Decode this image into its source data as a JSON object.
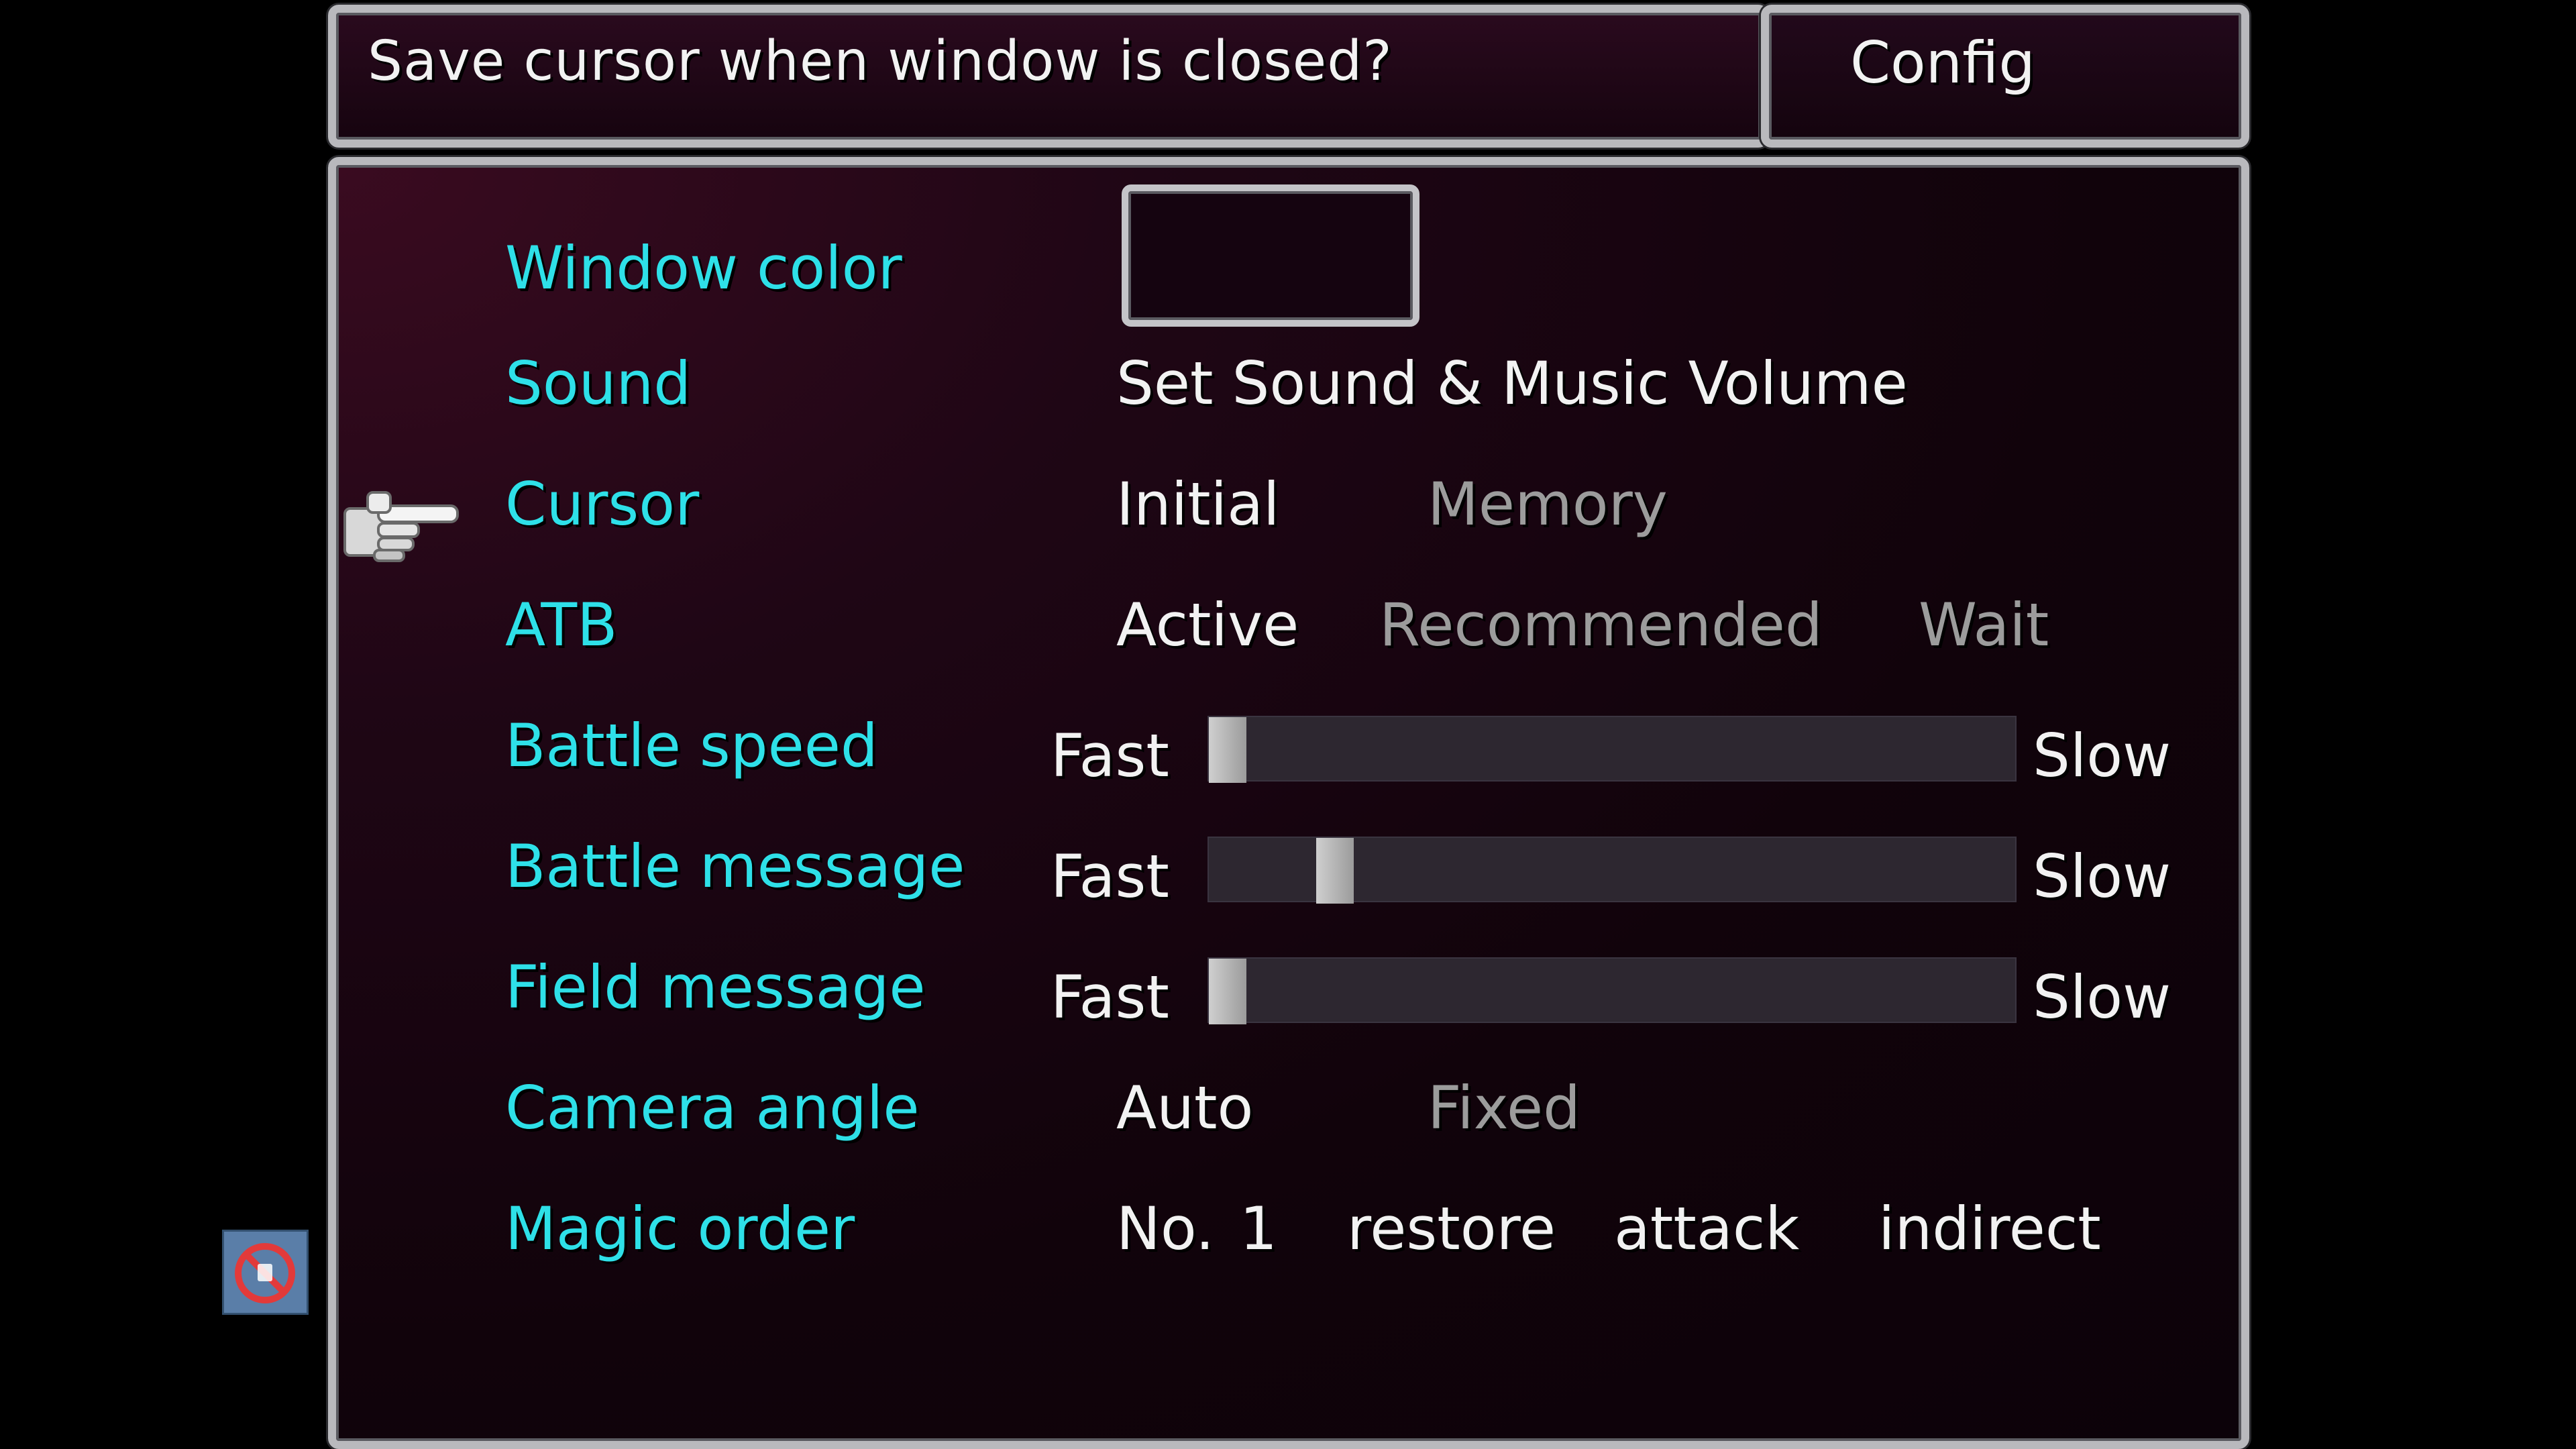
{
  "help": {
    "text": "Save cursor when window is closed?"
  },
  "title": {
    "text": "Config"
  },
  "settings": {
    "window_color": {
      "label": "Window color"
    },
    "sound": {
      "label": "Sound",
      "value": "Set Sound & Music Volume"
    },
    "cursor": {
      "label": "Cursor",
      "options": [
        "Initial",
        "Memory"
      ],
      "selected": "Initial"
    },
    "atb": {
      "label": "ATB",
      "options": [
        "Active",
        "Recommended",
        "Wait"
      ],
      "selected": "Active"
    },
    "battle_speed": {
      "label": "Battle speed",
      "min_label": "Fast",
      "max_label": "Slow",
      "level": 0.0
    },
    "battle_message": {
      "label": "Battle message",
      "min_label": "Fast",
      "max_label": "Slow",
      "level": 0.14
    },
    "field_message": {
      "label": "Field message",
      "min_label": "Fast",
      "max_label": "Slow",
      "level": 0.0
    },
    "camera_angle": {
      "label": "Camera angle",
      "options": [
        "Auto",
        "Fixed"
      ],
      "selected": "Auto"
    },
    "magic_order": {
      "label": "Magic order",
      "prefix": "No.",
      "number": "1",
      "items": [
        "restore",
        "attack",
        "indirect"
      ]
    }
  },
  "colors": {
    "label": "#2ee0e8",
    "selected_option": "#f2f2f2",
    "unselected_option": "#9c9c9c"
  },
  "icons": {
    "pointer": "hand-pointer-icon",
    "badge": "no-entry-icon"
  }
}
